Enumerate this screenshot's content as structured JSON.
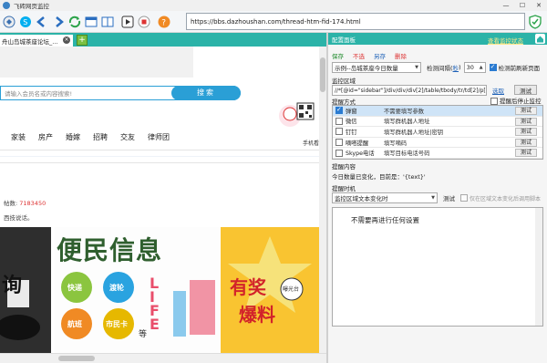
{
  "window": {
    "title": "飞砖网页监控",
    "min": "—",
    "max": "☐",
    "close": "✕"
  },
  "toolbar": {
    "url": "https://bbs.dazhoushan.com/thread-htm-fid-174.html"
  },
  "tabs": {
    "active_label": "舟山岛城茶座论坛_...",
    "close": "×",
    "add": "+"
  },
  "webpage": {
    "search_placeholder": "请输入会员名或内容搜索!",
    "search_button": "搜索",
    "qr_caption": "手机看",
    "nav": [
      "家装",
      "房产",
      "婚嫁",
      "招聘",
      "交友",
      "律师团"
    ],
    "posts_prefix": "帖数: ",
    "posts_count": "7183450",
    "slogan": "西技说话。",
    "banner_title": "便民信息",
    "banner_items": [
      "快递",
      "渡轮",
      "航班",
      "市民卡"
    ],
    "banner_side": "LIFE",
    "banner_deng": "等",
    "banner_right_top": "有奖",
    "banner_right_badge": "曝光台",
    "banner_right_bottom": "爆料",
    "banner_left": "询"
  },
  "panel": {
    "title": "配置面板",
    "link": "查看监控状态",
    "actions": [
      "保存",
      "不选",
      "另存",
      "删除"
    ],
    "example_select": "示例--岛城茶座今日数量",
    "interval_label": "检测间隔(",
    "interval_unit_link": "秒",
    "interval_close": ")",
    "interval_value": "30",
    "refresh_label": "检测前刷新页面",
    "monitor_area_label": "监控区域",
    "xpath": "//*[@id=\"sidebar\"]/div/div/div[2]/table/tbody/tr/td[2]/p[",
    "select_link": "选取",
    "test_btn": "测试",
    "alert_method_label": "提醒方式",
    "stop_after_alert": "提醒后停止监控",
    "alerts": [
      {
        "name": "弹窗",
        "desc": "不需要填写参数",
        "test": "测试",
        "checked": true,
        "color": "#3a7bd5"
      },
      {
        "name": "微信",
        "desc": "填写群机器人地址",
        "test": "测试",
        "checked": false,
        "color": "#2dbb4a"
      },
      {
        "name": "钉钉",
        "desc": "填写群机器人地址|密钥",
        "test": "测试",
        "checked": false,
        "color": "#3296fa"
      },
      {
        "name": "嘀嗒提醒",
        "desc": "填写嘀码",
        "test": "测试",
        "checked": false,
        "color": "#e8a321"
      },
      {
        "name": "Skype电话",
        "desc": "填写目标电话号码",
        "test": "测试",
        "checked": false,
        "color": "#00aff0"
      }
    ],
    "content_label": "提醒内容",
    "content_template": "今日数量已变化，目前是：'{text}'",
    "timing_label": "提醒时机",
    "timing_select": "监控区域文本变化时",
    "timing_test": "测试",
    "timing_only": "仅在区域文本变化后调用脚本",
    "message": "不需要再进行任何设置"
  }
}
